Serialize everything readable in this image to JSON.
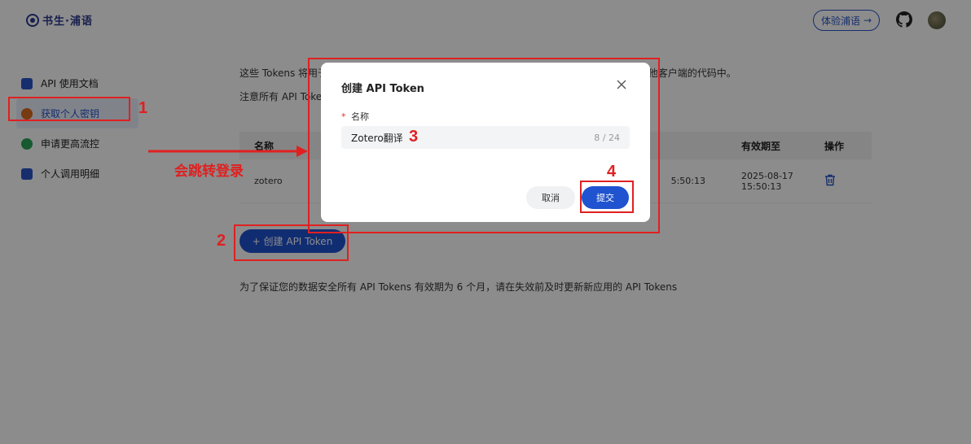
{
  "header": {
    "logo_text": "书生·浦语",
    "try_button": "体验浦语",
    "try_arrow": "→"
  },
  "sidebar": {
    "items": [
      {
        "label": "API 使用文档",
        "icon": "document-icon",
        "color": "#2a55c8"
      },
      {
        "label": "获取个人密钥",
        "icon": "key-icon",
        "color": "#d96a1f",
        "active": true
      },
      {
        "label": "申请更高流控",
        "icon": "flow-icon",
        "color": "#2aa45a"
      },
      {
        "label": "个人调用明细",
        "icon": "chart-icon",
        "color": "#2a55c8"
      }
    ]
  },
  "main": {
    "desc_start": "这些 Tokens 将用于",
    "desc_end": "其他客户端的代码中。",
    "desc2": "注意所有 API Tokens",
    "table": {
      "headers": {
        "name": "名称",
        "expire": "有效期至",
        "op": "操作"
      },
      "row": {
        "name": "zotero",
        "created_partial": "5:50:13",
        "expire": "2025-08-17 15:50:13"
      }
    },
    "create_button": "+ 创建 API Token",
    "note": "为了保证您的数据安全所有 API Tokens 有效期为 6 个月，请在失效前及时更新新应用的 API Tokens"
  },
  "modal": {
    "title": "创建 API Token",
    "required_mark": "*",
    "field_label": "名称",
    "input_value": "Zotero翻译",
    "char_count": "8 / 24",
    "cancel": "取消",
    "submit": "提交"
  },
  "annotations": {
    "n1": "1",
    "n2": "2",
    "n3": "3",
    "n4": "4",
    "redirect_text": "会跳转登录",
    "color": "#e02020"
  }
}
